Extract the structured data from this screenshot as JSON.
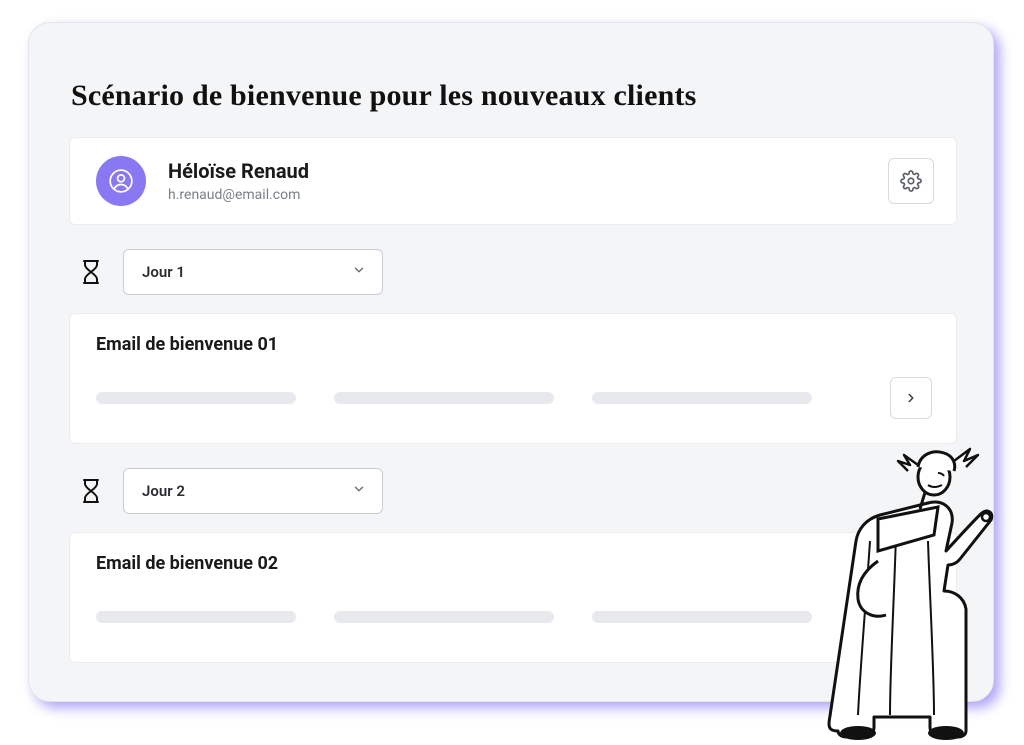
{
  "title": "Scénario de bienvenue pour les nouveaux clients",
  "contact": {
    "name": "Héloïse Renaud",
    "email": "h.renaud@email.com"
  },
  "days": [
    {
      "label": "Jour 1"
    },
    {
      "label": "Jour 2"
    }
  ],
  "emails": [
    {
      "title": "Email de bienvenue 01"
    },
    {
      "title": "Email de bienvenue 02"
    }
  ],
  "colors": {
    "accent": "#6b5df1",
    "avatar": "#8878f2"
  }
}
